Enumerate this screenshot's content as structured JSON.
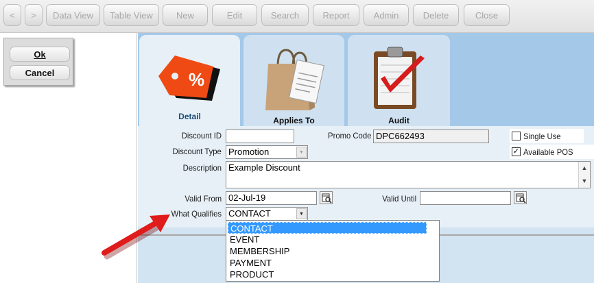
{
  "toolbar": {
    "prev_label": "<",
    "next_label": ">",
    "buttons": [
      "Data View",
      "Table View",
      "New",
      "Edit",
      "Search",
      "Report",
      "Admin",
      "Delete",
      "Close"
    ]
  },
  "left": {
    "ok_label": "Ok",
    "cancel_label": "Cancel"
  },
  "tabs": [
    {
      "label": "Detail",
      "icon": "discount-tag-icon"
    },
    {
      "label": "Applies To",
      "icon": "shopping-bag-icon"
    },
    {
      "label": "Audit",
      "icon": "clipboard-check-icon"
    }
  ],
  "form": {
    "discount_id_label": "Discount ID",
    "discount_id_value": "",
    "promo_code_label": "Promo Code",
    "promo_code_value": "DPC662493",
    "single_use_label": "Single Use",
    "single_use_checked": false,
    "discount_type_label": "Discount Type",
    "discount_type_value": "Promotion",
    "available_pos_label": "Available POS",
    "available_pos_checked": true,
    "description_label": "Description",
    "description_value": "Example Discount",
    "valid_from_label": "Valid From",
    "valid_from_value": "02-Jul-19",
    "valid_until_label": "Valid Until",
    "valid_until_value": "",
    "what_qualifies_label": "What Qualifies",
    "what_qualifies_value": "CONTACT",
    "what_qualifies_options": [
      "CONTACT",
      "EVENT",
      "MEMBERSHIP",
      "PAYMENT",
      "PRODUCT"
    ],
    "selected_option": "CONTACT"
  },
  "colors": {
    "panel_blue": "#a4c8e8",
    "form_bg": "#e7f0f7",
    "selection": "#3399ff",
    "arrow": "#e01b1b"
  }
}
